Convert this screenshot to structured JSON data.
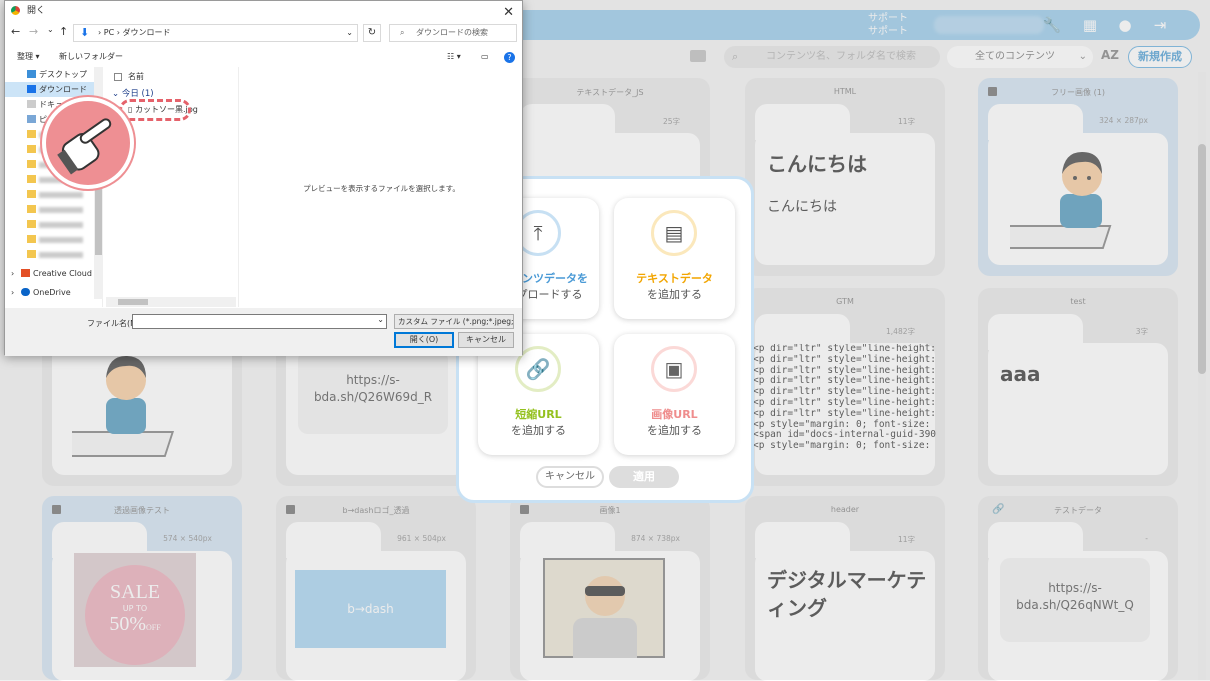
{
  "header": {
    "support_line1": "サポート",
    "support_line2": "サポート",
    "icons": [
      "wrench-icon",
      "grid-icon",
      "chat-icon",
      "logout-icon"
    ]
  },
  "toolbar": {
    "search_placeholder": "コンテンツ名、フォルダ名で検索",
    "filter_value": "全てのコンテンツ",
    "sort_label": "AZ",
    "new_button": "新規作成"
  },
  "cards_row1": [
    {
      "title": "テキストデータ_JS",
      "count": "25字"
    },
    {
      "title": "HTML",
      "count": "11字",
      "big": "こんにちは",
      "mid": "こんにちは"
    },
    {
      "title": "フリー画像 (1)",
      "count": "324 × 287px"
    }
  ],
  "cards_row2": [
    {
      "url": "https://s-bda.sh/Q26W69d_R"
    },
    {
      "title": "GTM",
      "count": "1,482字",
      "lines": [
        "<p dir=\"ltr\" style=\"line-height: 1",
        "<p dir=\"ltr\" style=\"line-height: 1",
        "<p dir=\"ltr\" style=\"line-height: 1",
        "<p dir=\"ltr\" style=\"line-height: 1",
        "<p dir=\"ltr\" style=\"line-height: 1",
        "<p dir=\"ltr\" style=\"line-height: 1",
        "<p dir=\"ltr\" style=\"line-height: 1",
        "<p style=\"margin: 0; font-size: 18",
        "<span id=\"docs-internal-guid-390",
        "<p style=\"margin: 0; font-size: 18"
      ]
    },
    {
      "title": "test",
      "count": "3字",
      "big": "aaa"
    }
  ],
  "cards_row3": [
    {
      "title": "透過画像テスト",
      "count": "574 × 540px",
      "sale": "SALE",
      "upto": "UP TO",
      "pct": "50%",
      "off": "OFF"
    },
    {
      "title": "b→dashロゴ_透過",
      "count": "961 × 504px",
      "logo": "b→dash"
    },
    {
      "title": "画像1",
      "count": "874 × 738px"
    },
    {
      "title": "header",
      "count": "11字",
      "big": "デジタルマーケティング"
    },
    {
      "title": "テストデータ",
      "count": "-",
      "url": "https://s-bda.sh/Q26qNWt_Q"
    }
  ],
  "modal": {
    "opt1_l1": "コンテンツデータを",
    "opt1_l2": "アップロードする",
    "opt2_l1": "テキストデータ",
    "opt2_l2": "を追加する",
    "opt3_l1": "短縮URL",
    "opt3_l2": "を追加する",
    "opt4_l1": "画像URL",
    "opt4_l2": "を追加する",
    "cancel": "キャンセル",
    "apply": "適用",
    "colors": {
      "blue": "#4a9ad6",
      "yellow": "#f2a500",
      "green": "#94c11f",
      "red": "#ef8d8d"
    }
  },
  "dialog": {
    "title": "開く",
    "path_pc": "PC",
    "path_folder": "ダウンロード",
    "search_placeholder": "ダウンロードの検索",
    "organize": "整理 ▾",
    "new_folder": "新しいフォルダー",
    "nav_items": [
      "デスクトップ",
      "ダウンロード",
      "ドキュメント",
      "ピクチャ"
    ],
    "creative_cloud": "Creative Cloud File",
    "onedrive": "OneDrive",
    "col_name": "名前",
    "group": "今日 (1)",
    "file": "カットソー黒.jpg",
    "preview_msg": "プレビューを表示するファイルを選択します。",
    "filename_label": "ファイル名(N):",
    "filetype": "カスタム ファイル (*.png;*.jpeg;*.jp",
    "open": "開く(O)",
    "cancel": "キャンセル"
  }
}
